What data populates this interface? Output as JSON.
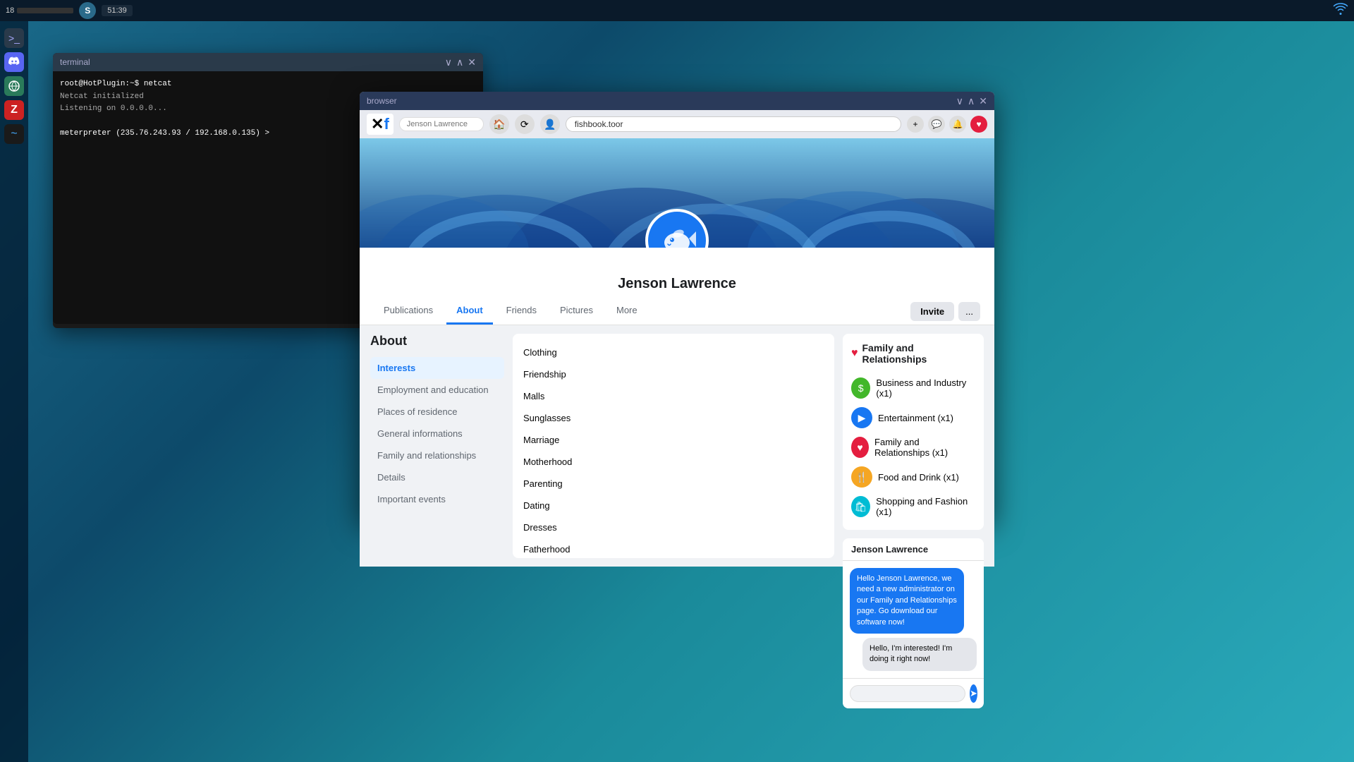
{
  "taskbar": {
    "number": "18",
    "bar_label": "",
    "app_logo": "S",
    "time": "51:39",
    "wifi_icon": "wifi"
  },
  "terminal": {
    "title": "terminal",
    "lines": [
      {
        "type": "prompt",
        "text": "root@HotPlugin:~$ netcat"
      },
      {
        "type": "output",
        "text": "Netcat initialized"
      },
      {
        "type": "output",
        "text": "Listening on 0.0.0.0..."
      },
      {
        "type": "blank",
        "text": ""
      },
      {
        "type": "prompt",
        "text": "meterpreter (235.76.243.93 / 192.168.0.135) >"
      }
    ]
  },
  "browser": {
    "title": "browser",
    "url": "fishbook.toor",
    "search_placeholder": "Jenson Lawrence",
    "logo_x": "X",
    "logo_f": "f",
    "profile_name": "Jenson Lawrence",
    "nav_items": [
      {
        "label": "Publications",
        "active": false
      },
      {
        "label": "About",
        "active": true
      },
      {
        "label": "Friends",
        "active": false
      },
      {
        "label": "Pictures",
        "active": false
      },
      {
        "label": "More",
        "active": false
      }
    ],
    "invite_label": "Invite",
    "dots_label": "...",
    "about_section": {
      "title": "About",
      "nav_items": [
        {
          "label": "Interests",
          "active": true
        },
        {
          "label": "Employment and education",
          "active": false
        },
        {
          "label": "Places of residence",
          "active": false
        },
        {
          "label": "General informations",
          "active": false
        },
        {
          "label": "Family and relationships",
          "active": false
        },
        {
          "label": "Details",
          "active": false
        },
        {
          "label": "Important events",
          "active": false
        }
      ],
      "interests": [
        "Clothing",
        "Friendship",
        "Malls",
        "Sunglasses",
        "Marriage",
        "Motherhood",
        "Parenting",
        "Dating",
        "Dresses",
        "Fatherhood"
      ]
    },
    "right_panel": {
      "title": "Family and Relationships",
      "items": [
        {
          "label": "Business and Industry (x1)",
          "icon": "$",
          "color": "green"
        },
        {
          "label": "Entertainment (x1)",
          "icon": "▶",
          "color": "blue"
        },
        {
          "label": "Family and Relationships (x1)",
          "icon": "♥",
          "color": "pink"
        },
        {
          "label": "Food and Drink (x1)",
          "icon": "🍴",
          "color": "orange"
        },
        {
          "label": "Shopping and Fashion (x1)",
          "icon": "🛍",
          "color": "teal"
        }
      ]
    },
    "chat": {
      "header": "Jenson Lawrence",
      "messages": [
        {
          "from": "them",
          "text": "Hello Jenson Lawrence, we need a new administrator on our Family and Relationships page. Go download our software now!"
        },
        {
          "from": "me",
          "text": "Hello, I'm interested! I'm doing it right now!"
        }
      ],
      "input_placeholder": ""
    }
  },
  "left_sidebar": {
    "icons": [
      {
        "name": "terminal-icon",
        "symbol": ">_",
        "color": "terminal"
      },
      {
        "name": "discord-icon",
        "symbol": "💬",
        "color": "discord"
      },
      {
        "name": "browser-icon",
        "symbol": "🌐",
        "color": "browser"
      },
      {
        "name": "metasploit-icon",
        "symbol": "Z",
        "color": "metasploit"
      },
      {
        "name": "script-icon",
        "symbol": "~",
        "color": "script"
      }
    ]
  }
}
